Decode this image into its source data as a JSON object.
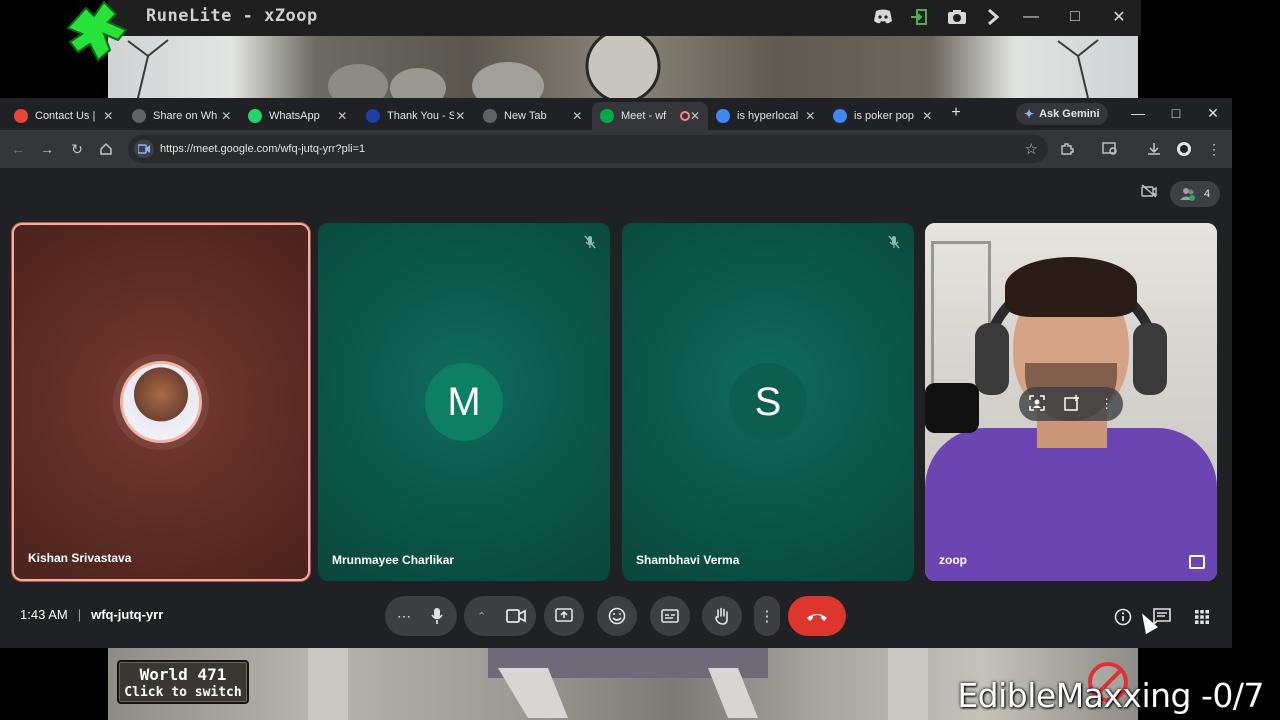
{
  "runelite": {
    "title": "RuneLite - xZoop",
    "world_line1": "World 471",
    "world_line2": "Click to switch"
  },
  "stream_overlay": "EdibleMaxxing -0/7",
  "browser": {
    "tabs": [
      {
        "label": "Contact Us | ",
        "favicon": "red-circle-icon",
        "color": "#e8453c"
      },
      {
        "label": "Share on Wh",
        "favicon": "globe-icon",
        "color": "#5f6368"
      },
      {
        "label": "WhatsApp",
        "favicon": "whatsapp-icon",
        "color": "#25d366"
      },
      {
        "label": "Thank You - S",
        "favicon": "blue-site-icon",
        "color": "#1a3fa8"
      },
      {
        "label": "New Tab",
        "favicon": "chrome-icon",
        "color": "#5f6368"
      },
      {
        "label": "Meet - wf",
        "favicon": "meet-icon",
        "color": "#00ac47",
        "active": true
      },
      {
        "label": "is hyperlocal",
        "favicon": "google-icon",
        "color": "#4285f4"
      },
      {
        "label": "is poker pop",
        "favicon": "google-icon",
        "color": "#4285f4"
      }
    ],
    "gemini_label": "Ask Gemini",
    "url": "https://meet.google.com/wfq-jutq-yrr?pli=1"
  },
  "meet": {
    "participant_count": "4",
    "participants": [
      {
        "name": "Kishan Srivastava",
        "avatar": "photo"
      },
      {
        "name": "Mrunmayee Charlikar",
        "initial": "M",
        "muted": true
      },
      {
        "name": "Shambhavi Verma",
        "initial": "S",
        "muted": true
      },
      {
        "name": "zoop",
        "avatar": "camera"
      }
    ],
    "time": "1:43 AM",
    "meeting_code": "wfq-jutq-yrr",
    "colors": {
      "leave": "#dc362e",
      "accent_tile": "#f6aea3",
      "tile_green": "#0b5648"
    }
  }
}
